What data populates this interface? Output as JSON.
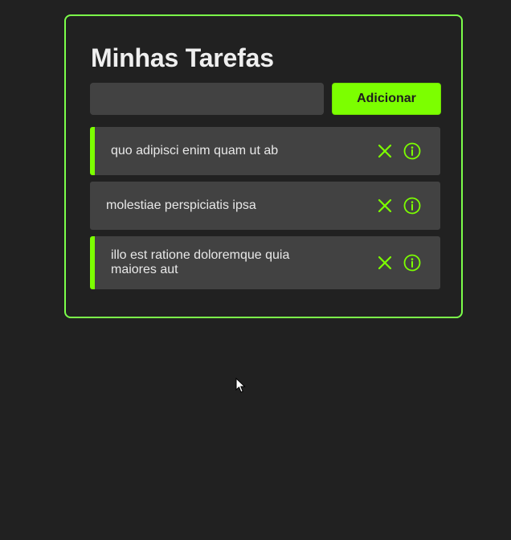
{
  "app": {
    "title": "Minhas Tarefas"
  },
  "new_task": {
    "value": "",
    "placeholder": "",
    "add_label": "Adicionar"
  },
  "tasks": [
    {
      "label": "quo adipisci enim quam ut ab",
      "completed": true
    },
    {
      "label": "molestiae perspiciatis ipsa",
      "completed": false
    },
    {
      "label": "illo est ratione doloremque quia maiores aut",
      "completed": true
    }
  ],
  "icons": {
    "delete": "close-icon",
    "details": "info-icon",
    "pointer": "mouse-pointer-icon"
  },
  "colors": {
    "background": "#212121",
    "accent": "#7CFF00",
    "card_border": "#7CFF4A",
    "task_background": "#424242",
    "text": "#efefef"
  }
}
